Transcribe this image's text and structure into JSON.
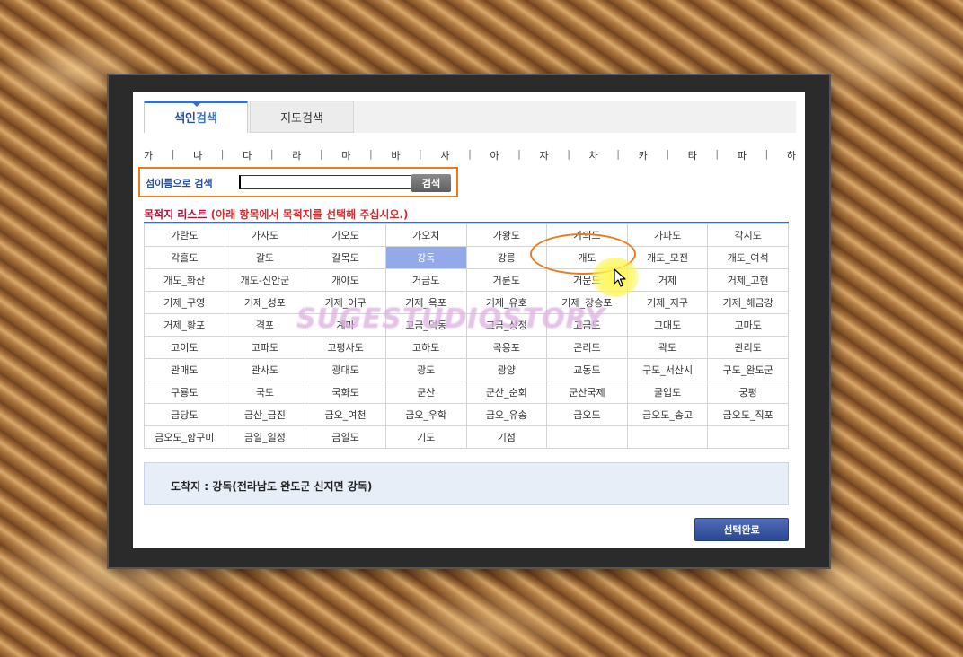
{
  "tabs": [
    {
      "label_a": "색인",
      "label_b": "검색"
    },
    {
      "label": "지도검색"
    }
  ],
  "alphabet": [
    "가",
    "나",
    "다",
    "라",
    "마",
    "바",
    "사",
    "아",
    "자",
    "차",
    "카",
    "타",
    "파",
    "하"
  ],
  "search": {
    "label": "섬이름으로 검색",
    "value": "",
    "button": "검색"
  },
  "list": {
    "title": "목적지 리스트",
    "note": "(아래 항목에서 목적지를 선택해 주십시오.)",
    "rows": [
      [
        "가란도",
        "가사도",
        "가오도",
        "가오치",
        "가왕도",
        "가의도",
        "가파도",
        "각시도"
      ],
      [
        "각흘도",
        "갈도",
        "갈목도",
        "강독",
        "강릉",
        "개도",
        "개도_모전",
        "개도_여석"
      ],
      [
        "개도_화산",
        "개도-신안군",
        "개야도",
        "거금도",
        "거륜도",
        "거문도",
        "거제",
        "거제_고현"
      ],
      [
        "거제_구영",
        "거제_성포",
        "거제_어구",
        "거제_옥포",
        "거제_유호",
        "거제_장승포",
        "거제_저구",
        "거제_해금강"
      ],
      [
        "거제_황포",
        "격포",
        "계마",
        "고금_덕동",
        "고금_상정",
        "고금도",
        "고대도",
        "고마도"
      ],
      [
        "고이도",
        "고파도",
        "고평사도",
        "고하도",
        "곡용포",
        "곤리도",
        "곽도",
        "관리도"
      ],
      [
        "관매도",
        "관사도",
        "광대도",
        "광도",
        "광양",
        "교동도",
        "구도_서산시",
        "구도_완도군"
      ],
      [
        "구룡도",
        "국도",
        "국화도",
        "군산",
        "군산_순회",
        "군산국제",
        "굴업도",
        "궁평"
      ],
      [
        "금당도",
        "금산_금진",
        "금오_여천",
        "금오_우학",
        "금오_유송",
        "금오도",
        "금오도_송고",
        "금오도_직포"
      ],
      [
        "금오도_함구미",
        "금일_일정",
        "금일도",
        "기도",
        "기섬",
        "",
        "",
        ""
      ]
    ],
    "selected": "강독"
  },
  "destination": {
    "text": "도착지 : 강독(전라남도 완도군 신지면 강독)"
  },
  "done_button": "선택완료",
  "watermark": "SUGESTUDIOSTORY",
  "colors": {
    "accent": "#3a6fc4",
    "highlight": "#ee7a1f",
    "selected_cell": "#93a9e8",
    "title_red": "#b3163a"
  }
}
